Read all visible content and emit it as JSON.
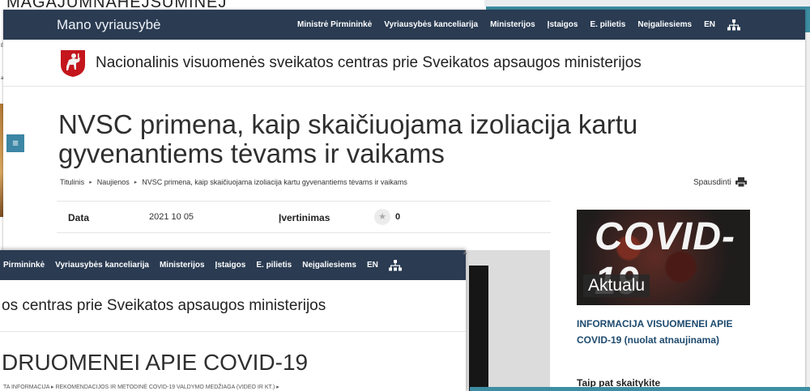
{
  "brand": "Mano vyriausybė",
  "nav": [
    "Ministrė Pirmininkė",
    "Vyriausybės kanceliarija",
    "Ministerijos",
    "Įstaigos",
    "E. pilietis",
    "Neįgaliesiems",
    "EN"
  ],
  "institution": "Nacionalinis visuomenės sveikatos centras prie Sveikatos apsaugos ministerijos",
  "title": "NVSC primena, kaip skaičiuojama izoliacija kartu gyvenantiems tėvams ir vaikams",
  "breadcrumb": [
    "Titulinis",
    "Naujienos",
    "NVSC primena, kaip skaičiuojama izoliacija kartu gyvenantiems tėvams ir vaikams"
  ],
  "print_label": "Spausdinti",
  "meta": {
    "date_label": "Data",
    "date_value": "2021 10 05",
    "rating_label": "Įvertinimas",
    "rating_value": "0"
  },
  "sidebar": {
    "image_word": "COVID-19",
    "badge": "Aktualu",
    "link": "INFORMACIJA VISUOMENEI APIE COVID-19 (nuolat atnaujinama)",
    "also_read": "Taip pat skaitykite"
  },
  "overlay": {
    "nav": [
      "Pirmininkė",
      "Vyriausybės kanceliarija",
      "Ministerijos",
      "Įstaigos",
      "E. pilietis",
      "Neįgaliesiems",
      "EN"
    ],
    "institution": "os centras prie Sveikatos apsaugos ministerijos",
    "title": "DRUOMENEI APIE COVID-19",
    "breadcrumb": "TA INFORMACIJA  ▸  REKOMENDACIJOS IR METODINĖ COVID-19 VALDYMO MEDŽIAGA (VIDEO IR KT.)  ▸"
  },
  "background": {
    "top_text": "MAGAJUMNAHEJSUMINEJ",
    "left_mini": [
      "ĖS",
      "a"
    ]
  }
}
